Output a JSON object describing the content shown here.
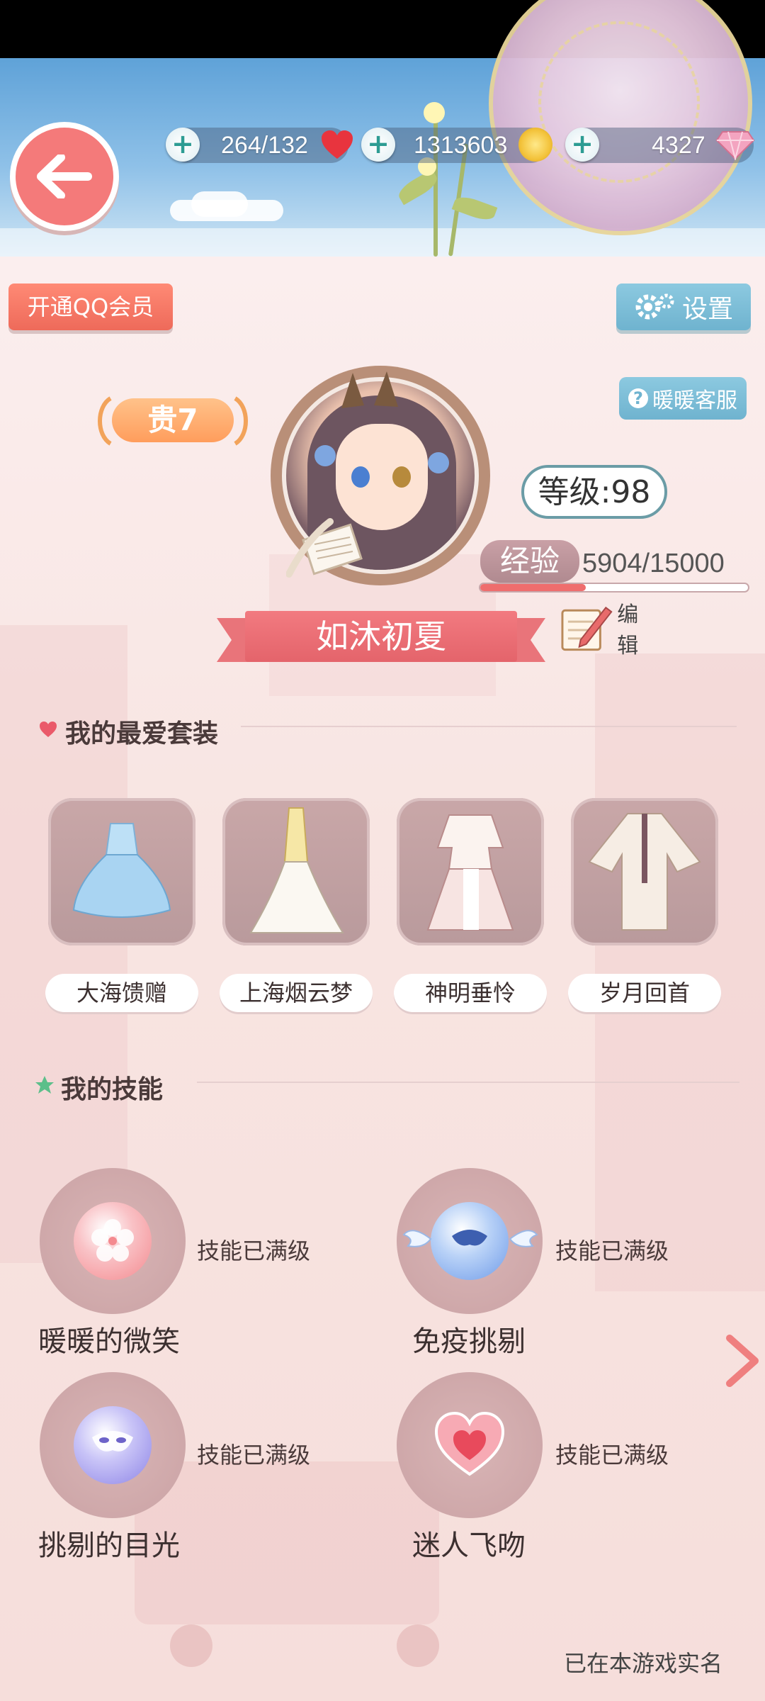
{
  "currency": {
    "stamina": "264/132",
    "gold": "1313603",
    "diamonds": "4327"
  },
  "buttons": {
    "qq_member": "开通QQ会员",
    "settings": "设置",
    "customer_service": "暖暖客服",
    "edit": "编 辑"
  },
  "profile": {
    "vip": "贵7",
    "level": "等级:98",
    "exp_label": "经验",
    "exp_value": "5904/15000",
    "exp_progress": 0.394,
    "name": "如沐初夏"
  },
  "favorites": {
    "title": "我的最爱套装",
    "items": [
      {
        "name": "大海馈赠"
      },
      {
        "name": "上海烟云梦"
      },
      {
        "name": "神明垂怜"
      },
      {
        "name": "岁月回首"
      }
    ]
  },
  "skills": {
    "title": "我的技能",
    "items": [
      {
        "name": "暖暖的微笑",
        "status": "技能已满级",
        "icon": "sakura-icon",
        "color": "#f48a8f"
      },
      {
        "name": "免疫挑剔",
        "status": "技能已满级",
        "icon": "winged-mask-icon",
        "color": "#6f9be8"
      },
      {
        "name": "挑剔的目光",
        "status": "技能已满级",
        "icon": "mask-icon",
        "color": "#8d84e6"
      },
      {
        "name": "迷人飞吻",
        "status": "技能已满级",
        "icon": "heart-icon",
        "color": "#f27a86"
      }
    ]
  },
  "footer": {
    "realname": "已在本游戏实名"
  },
  "colors": {
    "accent_red": "#ef6d6d",
    "accent_blue": "#7dbcd6",
    "vip_orange": "#ff9d5c"
  }
}
